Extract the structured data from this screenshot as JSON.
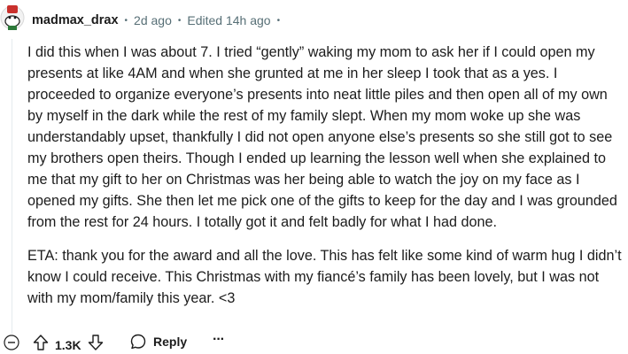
{
  "comment": {
    "username": "madmax_drax",
    "age": "2d ago",
    "edited": "Edited 14h ago",
    "paragraphs": [
      "I did this when I was about 7. I tried “gently” waking my mom to ask her if I could open my presents at like 4AM and when she grunted at me in her sleep I took that as a yes. I proceeded to organize everyone’s presents into neat little piles and then open all of my own by myself in the dark while the rest of my family slept. When my mom woke up she was understandably upset, thankfully I did not open anyone else’s presents so she still got to see my brothers open theirs. Though I ended up learning the lesson well when she explained to me that my gift to her on Christmas was her being able to watch the joy on my face as I opened my gifts. She then let me pick one of the gifts to keep for the day and I was grounded from the rest for 24 hours. I totally got it and felt badly for what I had done.",
      "ETA: thank you for the award and all the love. This has felt like some kind of warm hug I didn’t know I could receive. This Christmas with my fiancé’s family has been lovely, but I was not with my mom/family this year. <3"
    ]
  },
  "actions": {
    "vote_count": "1.3K",
    "reply_label": "Reply",
    "more_label": "···"
  },
  "icons": {
    "avatar": "avatar-icon",
    "collapse": "collapse-minus-icon",
    "upvote": "upvote-arrow-icon",
    "downvote": "downvote-arrow-icon",
    "reply": "speech-bubble-icon",
    "more": "more-options-icon"
  }
}
